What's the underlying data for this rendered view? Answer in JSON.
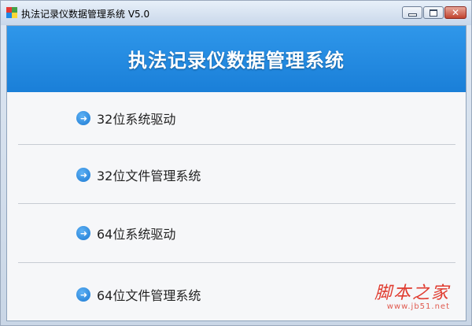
{
  "window": {
    "title": "执法记录仪数据管理系统 V5.0",
    "close_glyph": "✕"
  },
  "banner": {
    "title": "执法记录仪数据管理系统"
  },
  "menu": {
    "items": [
      {
        "label": "32位系统驱动",
        "icon": "arrow-right-circle-icon"
      },
      {
        "label": "32位文件管理系统",
        "icon": "arrow-right-circle-icon"
      },
      {
        "label": "64位系统驱动",
        "icon": "arrow-right-circle-icon"
      },
      {
        "label": "64位文件管理系统",
        "icon": "arrow-right-circle-icon"
      }
    ],
    "arrow_glyph": "➜"
  },
  "watermark": {
    "main": "脚本之家",
    "sub": "www.jb51.net"
  },
  "colors": {
    "banner": "#1a7fd8",
    "icon": "#1b79d2",
    "watermark": "#e03b2f"
  }
}
